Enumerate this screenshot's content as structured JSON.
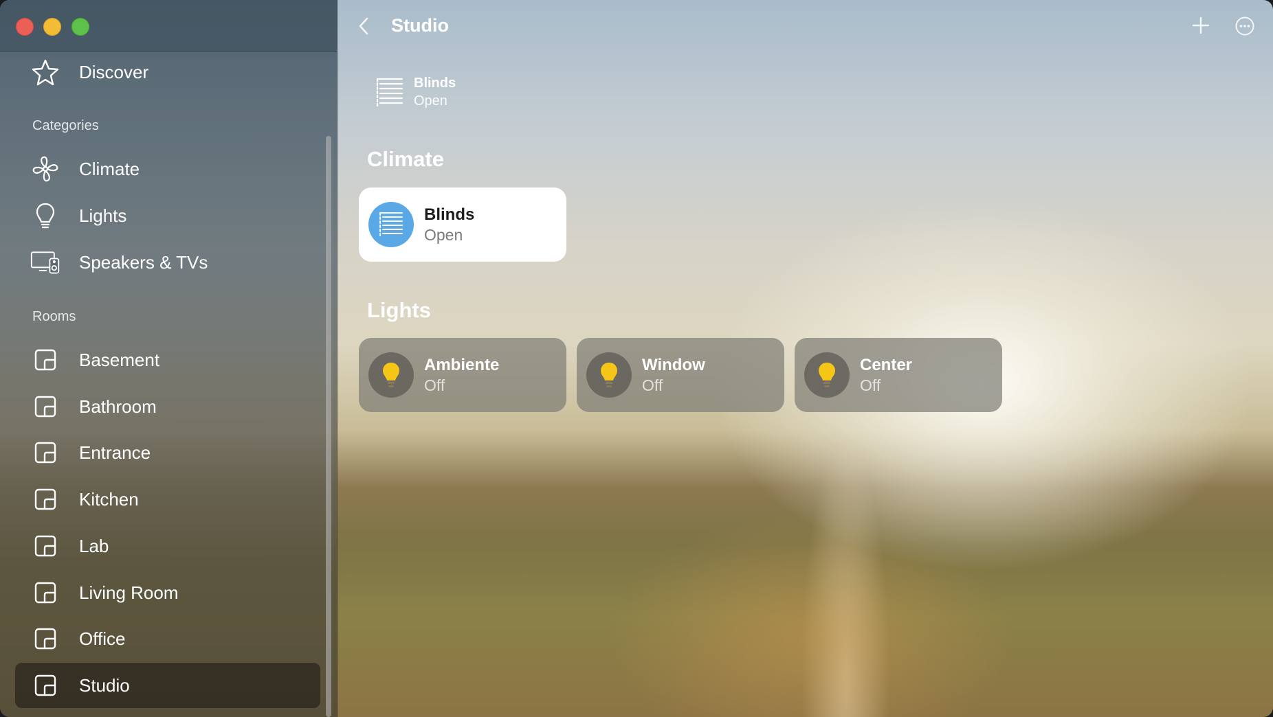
{
  "window": {
    "title": "Studio"
  },
  "sidebar": {
    "discover": {
      "label": "Discover",
      "icon": "star-icon"
    },
    "categories_header": "Categories",
    "categories": [
      {
        "label": "Climate",
        "icon": "fan-icon"
      },
      {
        "label": "Lights",
        "icon": "lightbulb-icon"
      },
      {
        "label": "Speakers & TVs",
        "icon": "tv-speaker-icon"
      }
    ],
    "rooms_header": "Rooms",
    "rooms": [
      {
        "label": "Basement",
        "selected": false
      },
      {
        "label": "Bathroom",
        "selected": false
      },
      {
        "label": "Entrance",
        "selected": false
      },
      {
        "label": "Kitchen",
        "selected": false
      },
      {
        "label": "Lab",
        "selected": false
      },
      {
        "label": "Living Room",
        "selected": false
      },
      {
        "label": "Office",
        "selected": false
      },
      {
        "label": "Studio",
        "selected": true
      }
    ]
  },
  "header": {
    "title": "Studio",
    "back_icon": "chevron-left-icon",
    "add_icon": "plus-icon",
    "more_icon": "ellipsis-circle-icon"
  },
  "status": {
    "name": "Blinds",
    "state": "Open",
    "icon": "blinds-icon"
  },
  "sections": {
    "climate": {
      "title": "Climate",
      "tiles": [
        {
          "name": "Blinds",
          "state": "Open",
          "icon": "blinds-icon",
          "active": true
        }
      ]
    },
    "lights": {
      "title": "Lights",
      "tiles": [
        {
          "name": "Ambiente",
          "state": "Off",
          "icon": "lightbulb-icon",
          "active": false
        },
        {
          "name": "Window",
          "state": "Off",
          "icon": "lightbulb-icon",
          "active": false
        },
        {
          "name": "Center",
          "state": "Off",
          "icon": "lightbulb-icon",
          "active": false
        }
      ]
    }
  },
  "colors": {
    "accent_blue": "#5aa9e6",
    "bulb_yellow": "#f5c518",
    "selected_row": "#2c281e",
    "close": "#ec5f56",
    "minimize": "#f2bd35",
    "zoom": "#5ec24a"
  }
}
